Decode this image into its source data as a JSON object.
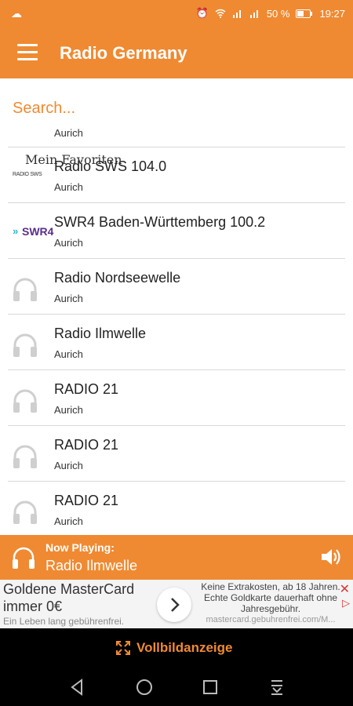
{
  "status": {
    "left_icon": "notification-icon",
    "battery": "50 %",
    "time": "19:27"
  },
  "appbar": {
    "title": "Radio Germany"
  },
  "search": {
    "placeholder": "Search..."
  },
  "overlay_text": "Mein Favoriten",
  "stations": [
    {
      "name": "",
      "city": "Aurich",
      "logo": "none"
    },
    {
      "name": "Radio SWS 104.0",
      "city": "Aurich",
      "logo": "sws",
      "logo_text": "RADIO SWS"
    },
    {
      "name": "SWR4 Baden-Württemberg 100.2",
      "city": "Aurich",
      "logo": "swr4",
      "logo_text": "SWR4"
    },
    {
      "name": "Radio Nordseewelle",
      "city": "Aurich",
      "logo": "headphones-icon"
    },
    {
      "name": "Radio Ilmwelle",
      "city": "Aurich",
      "logo": "headphones-icon"
    },
    {
      "name": "RADIO 21",
      "city": "Aurich",
      "logo": "headphones-icon"
    },
    {
      "name": "RADIO 21",
      "city": "Aurich",
      "logo": "headphones-icon"
    },
    {
      "name": "RADIO 21",
      "city": "Aurich",
      "logo": "headphones-icon"
    }
  ],
  "player": {
    "label": "Now Playing:",
    "station": "Radio Ilmwelle"
  },
  "ad": {
    "title_line1": "Goldene MasterCard",
    "title_line2": "immer 0€",
    "subtitle": "Ein Leben lang gebührenfrei.",
    "right_text": "Keine Extrakosten, ab 18 Jahren. Echte Goldkarte dauerhaft ohne Jahresgebühr.",
    "url": "mastercard.gebuhrenfrei.com/M..."
  },
  "fullscreen": {
    "label": "Vollbildanzeige"
  },
  "colors": {
    "accent": "#ef8a32",
    "swr_purple": "#5a2e8a",
    "swr_teal": "#2bb8c7"
  }
}
